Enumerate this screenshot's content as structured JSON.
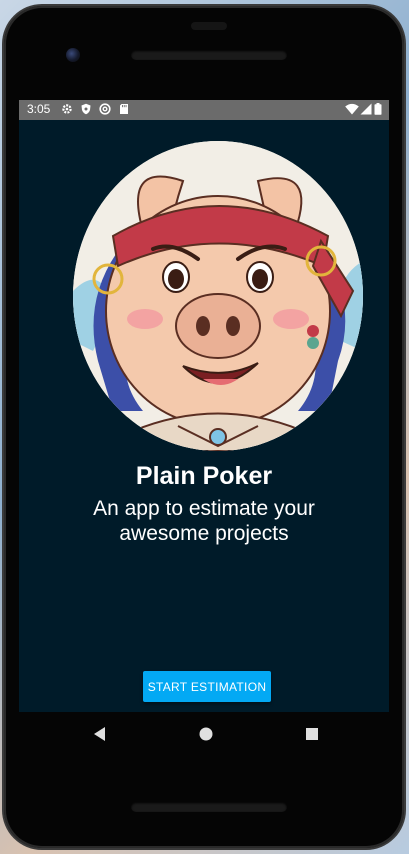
{
  "status_bar": {
    "time": "3:05",
    "left_icons": [
      "gear-icon",
      "shield-icon",
      "at-sign-icon",
      "sd-card-icon"
    ],
    "right_icons": [
      "wifi-icon",
      "cell-signal-icon",
      "battery-icon"
    ]
  },
  "hero": {
    "image": "pirate-pig-illustration"
  },
  "app": {
    "title": "Plain Poker",
    "subtitle": "An app to estimate your awesome projects",
    "start_button_label": "START ESTIMATION"
  },
  "nav_bar": {
    "buttons": [
      "back-icon",
      "home-icon",
      "recents-icon"
    ]
  },
  "colors": {
    "screen_background": "#001b29",
    "accent": "#03a9f4",
    "status_bar": "#6b6b6b"
  }
}
